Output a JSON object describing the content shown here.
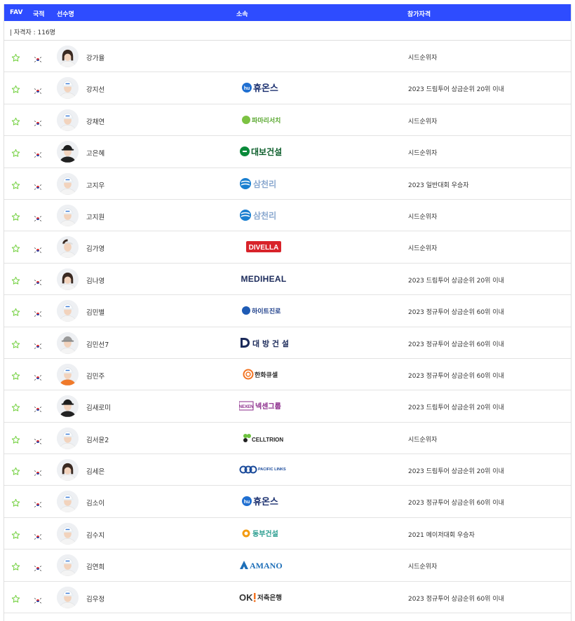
{
  "header": {
    "fav": "FAV",
    "country": "국적",
    "player": "선수명",
    "team": "소속",
    "qualification": "참가자격"
  },
  "count_label": "| 자격자 : 116명",
  "colors": {
    "header_bg": "#2e4cff",
    "star": "#6fcf3a"
  },
  "players": [
    {
      "name": "강가율",
      "team": "",
      "team_logo": "none",
      "qualification": "시드순위자",
      "avatar": "dark-hair-woman"
    },
    {
      "name": "강지선",
      "team": "휴온스",
      "team_logo": "huons",
      "qualification": "2023 드림투어 상금순위 20위 이내",
      "avatar": "cap-white"
    },
    {
      "name": "강채연",
      "team": "파마리서치",
      "team_logo": "pharmaresearch",
      "qualification": "시드순위자",
      "avatar": "cap-white"
    },
    {
      "name": "고은혜",
      "team": "대보건설",
      "team_logo": "daebo",
      "qualification": "시드순위자",
      "avatar": "cap-dark"
    },
    {
      "name": "고지우",
      "team": "삼천리",
      "team_logo": "samchully",
      "qualification": "2023 일반대회 우승자",
      "avatar": "cap-white"
    },
    {
      "name": "고지원",
      "team": "삼천리",
      "team_logo": "samchully",
      "qualification": "시드순위자",
      "avatar": "cap-white"
    },
    {
      "name": "김가영",
      "team": "DIVELLA",
      "team_logo": "divella",
      "qualification": "시드순위자",
      "avatar": "visor-white"
    },
    {
      "name": "김나영",
      "team": "MEDIHEAL",
      "team_logo": "mediheal",
      "qualification": "2023 드림투어 상금순위 20위 이내",
      "avatar": "dark-hair-woman"
    },
    {
      "name": "김민별",
      "team": "하이트진로",
      "team_logo": "hitejinro",
      "qualification": "2023 정규투어 상금순위 60위 이내",
      "avatar": "cap-white"
    },
    {
      "name": "김민선7",
      "team": "대 방 건 설",
      "team_logo": "daebang",
      "qualification": "2023 정규투어 상금순위 60위 이내",
      "avatar": "cap-gray"
    },
    {
      "name": "김민주",
      "team": "한화큐셀",
      "team_logo": "hanwha",
      "qualification": "2023 정규투어 상금순위 60위 이내",
      "avatar": "orange-shirt"
    },
    {
      "name": "김새로미",
      "team": "넥센그룹",
      "team_logo": "nexen",
      "qualification": "2023 드림투어 상금순위 20위 이내",
      "avatar": "cap-dark"
    },
    {
      "name": "김서윤2",
      "team": "CELLTRION",
      "team_logo": "celltrion",
      "qualification": "시드순위자",
      "avatar": "cap-white"
    },
    {
      "name": "김세은",
      "team": "PACIFIC LINKS",
      "team_logo": "pacificlinks",
      "qualification": "2023 드림투어 상금순위 20위 이내",
      "avatar": "dark-hair-woman"
    },
    {
      "name": "김소이",
      "team": "휴온스",
      "team_logo": "huons",
      "qualification": "2023 정규투어 상금순위 60위 이내",
      "avatar": "cap-white"
    },
    {
      "name": "김수지",
      "team": "동부건설",
      "team_logo": "dongbu",
      "qualification": "2021 메이저대회 우승자",
      "avatar": "cap-white"
    },
    {
      "name": "김연희",
      "team": "AMANO",
      "team_logo": "amano",
      "qualification": "시드순위자",
      "avatar": "cap-white"
    },
    {
      "name": "김우정",
      "team": "저축은행",
      "team_logo": "okbank",
      "qualification": "2023 정규투어 상금순위 60위 이내",
      "avatar": "cap-white"
    }
  ]
}
